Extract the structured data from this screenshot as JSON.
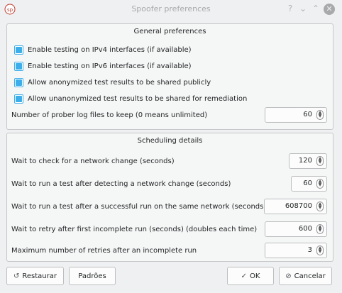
{
  "window": {
    "title": "Spoofer preferences"
  },
  "general": {
    "title": "General preferences",
    "checkboxes": [
      {
        "label": "Enable testing on IPv4 interfaces (if available)",
        "checked": true
      },
      {
        "label": "Enable testing on IPv6 interfaces (if available)",
        "checked": true
      },
      {
        "label": "Allow anonymized test results to be shared publicly",
        "checked": true
      },
      {
        "label": "Allow unanonymized test results to be shared for remediation",
        "checked": true
      }
    ],
    "log_files_label": "Number of prober log files to keep (0 means unlimited)",
    "log_files_value": "60"
  },
  "scheduling": {
    "title": "Scheduling details",
    "rows": [
      {
        "label": "Wait to check for a network change (seconds)",
        "value": "120"
      },
      {
        "label": "Wait to run a test after detecting a network change (seconds)",
        "value": "60"
      },
      {
        "label": "Wait to run a test after a successful run on the same network (seconds)",
        "value": "608700"
      },
      {
        "label": "Wait to retry after first incomplete run (seconds) (doubles each time)",
        "value": "600"
      },
      {
        "label": "Maximum number of retries after an incomplete run",
        "value": "3"
      }
    ]
  },
  "buttons": {
    "restore": "Restaurar",
    "defaults": "Padrões",
    "ok": "OK",
    "cancel": "Cancelar"
  },
  "colors": {
    "accent": "#3daee9"
  }
}
